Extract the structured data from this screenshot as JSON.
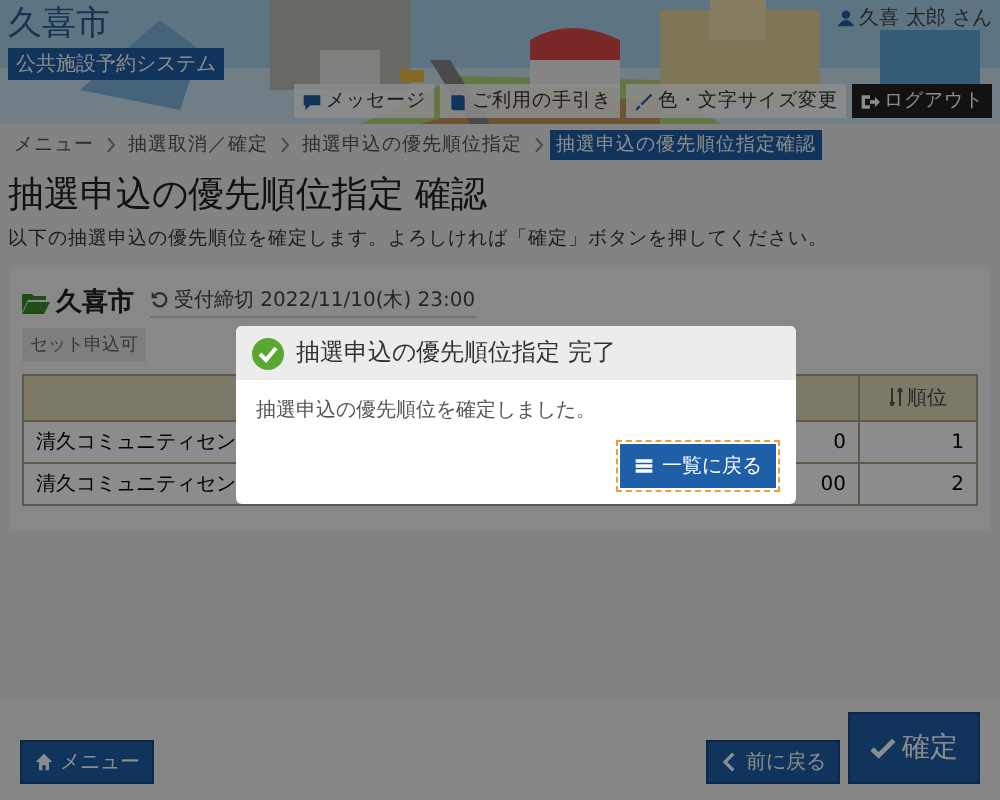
{
  "header": {
    "city": "久喜市",
    "system": "公共施設予約システム",
    "user": "久喜 太郎 さん",
    "buttons": [
      {
        "label": "メッセージ",
        "kind": "message"
      },
      {
        "label": "ご利用の手引き",
        "kind": "guide"
      },
      {
        "label": "色・文字サイズ変更",
        "kind": "style"
      },
      {
        "label": "ログアウト",
        "kind": "logout"
      }
    ]
  },
  "breadcrumb": [
    {
      "label": "メニュー",
      "selected": false
    },
    {
      "label": "抽選取消／確定",
      "selected": false
    },
    {
      "label": "抽選申込の優先順位指定",
      "selected": false
    },
    {
      "label": "抽選申込の優先順位指定確認",
      "selected": true
    }
  ],
  "page_title": "抽選申込の優先順位指定 確認",
  "description": "以下の抽選申込の優先順位を確定します。よろしければ「確定」ボタンを押してください。",
  "card": {
    "title": "久喜市",
    "deadline": "受付締切 2022/11/10(木) 23:00",
    "tag": "セット申込可",
    "table": {
      "columns": [
        {},
        {},
        {
          "label": "順位"
        }
      ],
      "rows": [
        {
          "facility": "清久コミュニティセン",
          "column_2": "0",
          "rank": "1"
        },
        {
          "facility": "清久コミュニティセン",
          "column_2": "00",
          "rank": "2"
        }
      ]
    }
  },
  "modal": {
    "title": "抽選申込の優先順位指定 完了",
    "message": "抽選申込の優先順位を確定しました。",
    "button": "一覧に戻る"
  },
  "footer": {
    "menu": "メニュー",
    "back": "前に戻る",
    "confirm": "確定"
  }
}
